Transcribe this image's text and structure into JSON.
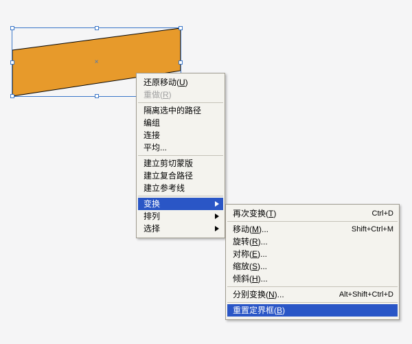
{
  "shape": {
    "fill": "#e79a2b",
    "stroke": "#000000"
  },
  "menu1": {
    "group1": [
      {
        "label_pre": "还原移动(",
        "mn": "U",
        "label_post": ")",
        "disabled": false
      },
      {
        "label_pre": "重做(",
        "mn": "R",
        "label_post": ")",
        "disabled": true
      }
    ],
    "group2": [
      {
        "label": "隔离选中的路径"
      },
      {
        "label": "编组"
      },
      {
        "label": "连接"
      },
      {
        "label": "平均...",
        "mn": ""
      }
    ],
    "group3": [
      {
        "label": "建立剪切蒙版"
      },
      {
        "label": "建立复合路径"
      },
      {
        "label": "建立参考线"
      }
    ],
    "group4": [
      {
        "label": "变换",
        "active": true
      },
      {
        "label": "排列"
      },
      {
        "label": "选择"
      }
    ]
  },
  "menu2": {
    "group1": [
      {
        "label_pre": "再次变换(",
        "mn": "T",
        "label_post": ")",
        "shortcut": "Ctrl+D"
      }
    ],
    "group2": [
      {
        "label_pre": "移动(",
        "mn": "M",
        "label_post": ")...",
        "shortcut": "Shift+Ctrl+M"
      },
      {
        "label_pre": "旋转(",
        "mn": "R",
        "label_post": ")..."
      },
      {
        "label_pre": "对称(",
        "mn": "E",
        "label_post": ")..."
      },
      {
        "label_pre": "缩放(",
        "mn": "S",
        "label_post": ")..."
      },
      {
        "label_pre": "倾斜(",
        "mn": "H",
        "label_post": ")..."
      }
    ],
    "group3": [
      {
        "label_pre": "分别变换(",
        "mn": "N",
        "label_post": ")...",
        "shortcut": "Alt+Shift+Ctrl+D"
      }
    ],
    "group4": [
      {
        "label_pre": "重置定界框(",
        "mn": "B",
        "label_post": ")",
        "active": true
      }
    ]
  }
}
